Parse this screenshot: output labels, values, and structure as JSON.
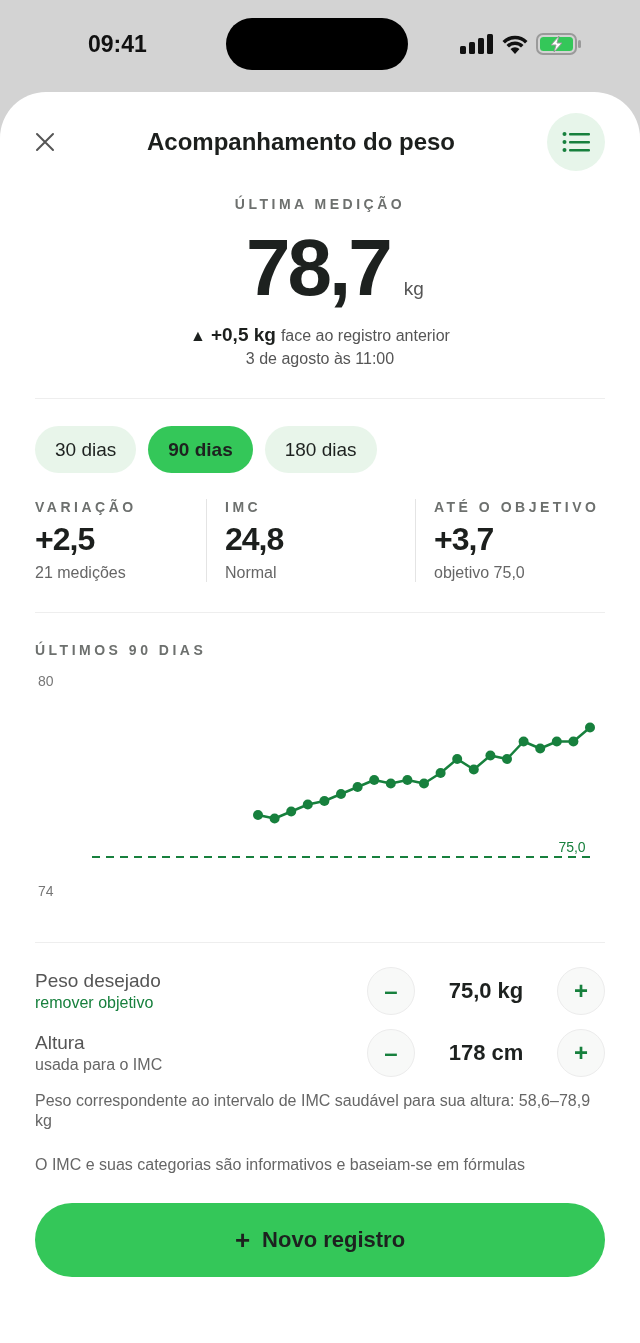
{
  "status_bar": {
    "time": "09:41"
  },
  "header": {
    "title": "Acompanhamento do peso"
  },
  "latest": {
    "label": "ÚLTIMA MEDIÇÃO",
    "value": "78,7",
    "unit": "kg",
    "change_icon": "▲",
    "change": "+0,5 kg",
    "change_note": "face ao registro anterior",
    "date": "3 de agosto às 11:00"
  },
  "ranges": [
    {
      "label": "30 dias",
      "selected": false
    },
    {
      "label": "90 dias",
      "selected": true
    },
    {
      "label": "180 dias",
      "selected": false
    }
  ],
  "stats": [
    {
      "label": "VARIAÇÃO",
      "value": "+2,5",
      "note": "21 medições"
    },
    {
      "label": "IMC",
      "value": "24,8",
      "note": "Normal"
    },
    {
      "label": "ATÉ O OBJETIVO",
      "value": "+3,7",
      "note": "objetivo 75,0"
    }
  ],
  "chart": {
    "title": "ÚLTIMOS 90 DIAS",
    "chart_data": {
      "type": "line",
      "categories": [
        null,
        null,
        null,
        null,
        null,
        null,
        null,
        null,
        null,
        null,
        null,
        null,
        null,
        null,
        null,
        null,
        null,
        null,
        null,
        null,
        null,
        null,
        null,
        null,
        null,
        null,
        null,
        null,
        null,
        null,
        null
      ],
      "ylim": [
        74,
        80
      ],
      "yticks": [
        74,
        80
      ],
      "series": [
        {
          "color": "#17803d",
          "marker": "circle",
          "values": [
            null,
            null,
            null,
            null,
            null,
            null,
            null,
            null,
            null,
            null,
            76.2,
            76.1,
            76.3,
            76.5,
            76.6,
            76.8,
            77.0,
            77.2,
            77.1,
            77.2,
            77.1,
            77.4,
            77.8,
            77.5,
            77.9,
            77.8,
            78.3,
            78.1,
            78.3,
            78.3,
            78.7
          ]
        }
      ],
      "ref_lines": [
        {
          "axis": "y",
          "value": 75,
          "label": "75,0"
        }
      ]
    }
  },
  "settings": [
    {
      "label": "Peso desejado",
      "sub": "remover objetivo",
      "kind": "link",
      "value": "75,0 kg",
      "minus": "–",
      "plus": "+"
    },
    {
      "label": "Altura",
      "sub": "usada para o IMC",
      "kind": "plain",
      "value": "178 cm",
      "minus": "–",
      "plus": "+"
    }
  ],
  "notes": [
    "Peso correspondente ao intervalo de IMC saudável para sua altura: 58,6–78,9 kg",
    "O IMC e suas categorias são informativos e baseiam-se em fórmulas"
  ],
  "add_button": {
    "icon": "+",
    "label": "Novo registro"
  }
}
